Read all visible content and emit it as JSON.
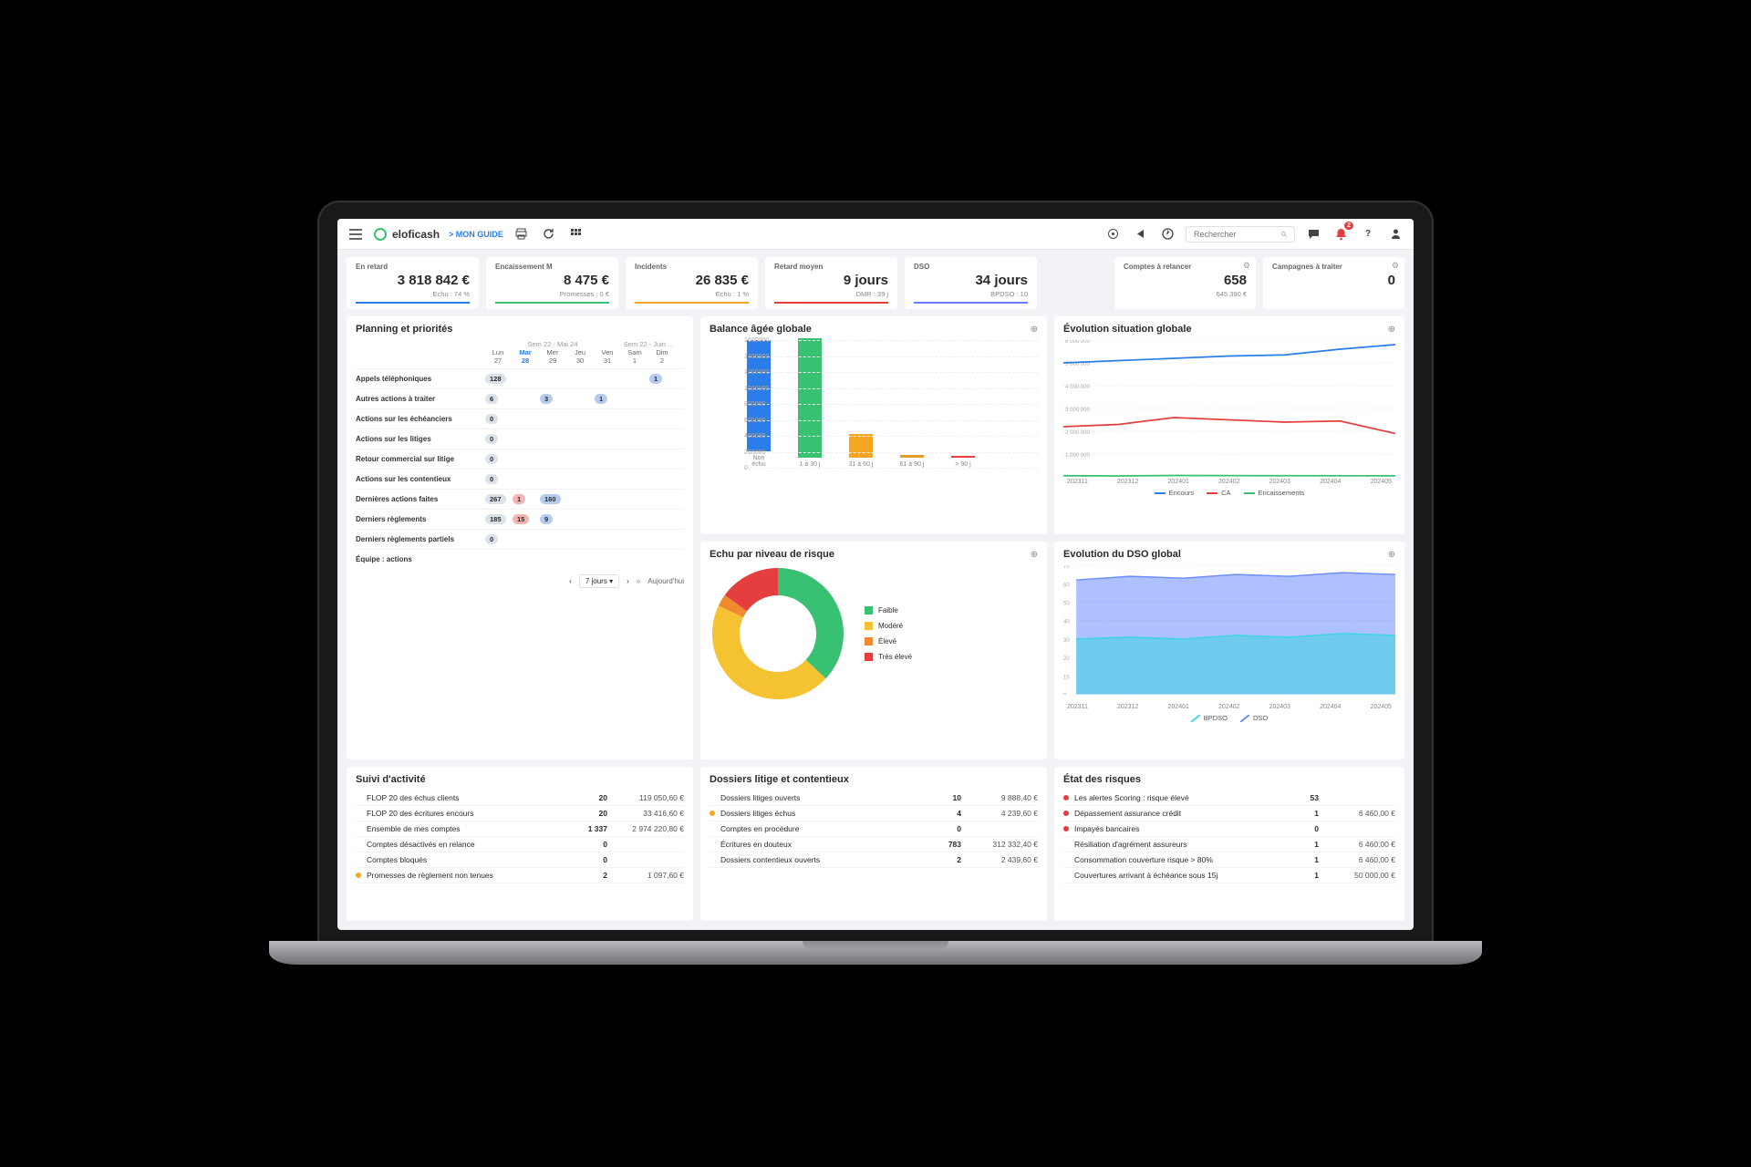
{
  "header": {
    "brand": "eloficash",
    "guide_label": "> MON GUIDE",
    "search_placeholder": "Rechercher",
    "notif_count": "2"
  },
  "kpis": [
    {
      "label": "En retard",
      "value": "3 818 842 €",
      "sub": "Echu : 74 %",
      "color": "#2b7de9"
    },
    {
      "label": "Encaissement M",
      "value": "8 475 €",
      "sub": "Promesses : 0 €",
      "color": "#38c172"
    },
    {
      "label": "Incidents",
      "value": "26 835 €",
      "sub": "Echu : 1 %",
      "color": "#f5a623"
    },
    {
      "label": "Retard moyen",
      "value": "9 jours",
      "sub": "DMR : 39 j",
      "color": "#e53e3e"
    },
    {
      "label": "DSO",
      "value": "34 jours",
      "sub": "BPDSO : 10",
      "color": "#6b7cff"
    }
  ],
  "kpis_right": [
    {
      "label": "Comptes à relancer",
      "value": "658",
      "sub": "645 390 €"
    },
    {
      "label": "Campagnes à traiter",
      "value": "0",
      "sub": ""
    }
  ],
  "balance": {
    "title": "Balance âgée globale",
    "ymax_label": "1 600 000"
  },
  "evolution": {
    "title": "Évolution situation globale",
    "legend": [
      "Encours",
      "CA",
      "Encaissements"
    ]
  },
  "risk": {
    "title": "Echu par niveau de risque",
    "legend": [
      "Faible",
      "Modéré",
      "Élevé",
      "Très élevé"
    ]
  },
  "dso": {
    "title": "Evolution du DSO global",
    "legend": [
      "BPDSO",
      "DSO"
    ]
  },
  "planning": {
    "title": "Planning et priorités",
    "week1": "Sem 22 - Mai 24",
    "week2": "Sem 22 - Juin ...",
    "days_short": [
      "Lun",
      "Mar",
      "Mer",
      "Jeu",
      "Ven",
      "Sam",
      "Dim"
    ],
    "days_num": [
      "27",
      "28",
      "29",
      "30",
      "31",
      "1",
      "2"
    ],
    "rows": [
      {
        "label": "Appels téléphoniques",
        "cells": [
          "128",
          "",
          "",
          "",
          "",
          "",
          "1"
        ]
      },
      {
        "label": "Autres actions à traiter",
        "cells": [
          "6",
          "",
          "3",
          "",
          "1",
          "",
          ""
        ]
      },
      {
        "label": "Actions sur les échéanciers",
        "cells": [
          "0",
          "",
          "",
          "",
          "",
          "",
          ""
        ]
      },
      {
        "label": "Actions sur les litiges",
        "cells": [
          "0",
          "",
          "",
          "",
          "",
          "",
          ""
        ]
      },
      {
        "label": "Retour commercial sur litige",
        "cells": [
          "0",
          "",
          "",
          "",
          "",
          "",
          ""
        ]
      },
      {
        "label": "Actions sur les contentieux",
        "cells": [
          "0",
          "",
          "",
          "",
          "",
          "",
          ""
        ]
      },
      {
        "label": "Dernières actions faites",
        "cells": [
          "267",
          "1",
          "160",
          "",
          "",
          "",
          ""
        ]
      },
      {
        "label": "Derniers règlements",
        "cells": [
          "185",
          "15",
          "9",
          "",
          "",
          "",
          ""
        ]
      },
      {
        "label": "Derniers règlements partiels",
        "cells": [
          "0",
          "",
          "",
          "",
          "",
          "",
          ""
        ]
      },
      {
        "label": "Équipe : actions",
        "cells": [
          "",
          "",
          "",
          "",
          "",
          "",
          ""
        ]
      }
    ],
    "range": "7 jours",
    "today": "Aujourd'hui"
  },
  "suivi": {
    "title": "Suivi d'activité",
    "rows": [
      {
        "label": "FLOP 20 des échus clients",
        "count": "20",
        "value": "119 050,60 €"
      },
      {
        "label": "FLOP 20 des écritures encours",
        "count": "20",
        "value": "33 416,60 €"
      },
      {
        "label": "Ensemble de mes comptes",
        "count": "1 337",
        "value": "2 974 220,80 €"
      },
      {
        "label": "Comptes désactivés en relance",
        "count": "0",
        "value": ""
      },
      {
        "label": "Comptes bloqués",
        "count": "0",
        "value": ""
      },
      {
        "label": "Promesses de règlement non tenues",
        "count": "2",
        "value": "1 097,60 €",
        "dot": "#f5a623"
      }
    ]
  },
  "litige": {
    "title": "Dossiers litige et contentieux",
    "rows": [
      {
        "label": "Dossiers litiges ouverts",
        "count": "10",
        "value": "9 888,40 €"
      },
      {
        "label": "Dossiers litiges échus",
        "count": "4",
        "value": "4 239,60 €",
        "dot": "#f5a623"
      },
      {
        "label": "Comptes en procédure",
        "count": "0",
        "value": ""
      },
      {
        "label": "Écritures en douteux",
        "count": "783",
        "value": "312 332,40 €"
      },
      {
        "label": "Dossiers contentieux ouverts",
        "count": "2",
        "value": "2 439,60 €"
      }
    ]
  },
  "risques": {
    "title": "État des risques",
    "rows": [
      {
        "label": "Les alertes Scoring : risque élevé",
        "count": "53",
        "value": "",
        "dot": "#e53e3e"
      },
      {
        "label": "Dépassement assurance crédit",
        "count": "1",
        "value": "6 460,00 €",
        "dot": "#e53e3e"
      },
      {
        "label": "Impayés bancaires",
        "count": "0",
        "value": "",
        "dot": "#e53e3e"
      },
      {
        "label": "Résiliation d'agrément assureurs",
        "count": "1",
        "value": "6 460,00 €"
      },
      {
        "label": "Consommation couverture risque > 80%",
        "count": "1",
        "value": "6 460,00 €"
      },
      {
        "label": "Couvertures arrivant à échéance sous 15j",
        "count": "1",
        "value": "50 000,00 €"
      }
    ]
  },
  "chart_data": {
    "balance_bar": {
      "type": "bar",
      "categories": [
        "Non échu",
        "1 à 30 j",
        "31 à 60 j",
        "61 à 90 j",
        "> 90 j"
      ],
      "values": [
        1400000,
        1500000,
        300000,
        30000,
        20000
      ],
      "colors": [
        "#2b7de9",
        "#38c172",
        "#f5a623",
        "#e89b2d",
        "#e53e3e"
      ],
      "ylim": [
        0,
        1600000
      ]
    },
    "evolution_line": {
      "type": "line",
      "x": [
        "202311",
        "202312",
        "202401",
        "202402",
        "202403",
        "202404",
        "202405"
      ],
      "series": [
        {
          "name": "Encours",
          "values": [
            5000000,
            5100000,
            5200000,
            5300000,
            5350000,
            5600000,
            5800000
          ],
          "color": "#2b7de9"
        },
        {
          "name": "CA",
          "values": [
            2200000,
            2300000,
            2600000,
            2500000,
            2400000,
            2450000,
            1900000
          ],
          "color": "#e53e3e"
        },
        {
          "name": "Encaissements",
          "values": [
            50000,
            40000,
            60000,
            55000,
            50000,
            48000,
            45000
          ],
          "color": "#38c172"
        }
      ],
      "ylim": [
        0,
        6000000
      ]
    },
    "risk_donut": {
      "type": "pie",
      "labels": [
        "Faible",
        "Modéré",
        "Élevé",
        "Très élevé"
      ],
      "values": [
        37,
        45,
        3,
        15
      ],
      "colors": [
        "#38c172",
        "#f5c331",
        "#f08a2d",
        "#e53e3e"
      ]
    },
    "dso_area": {
      "type": "area",
      "x": [
        "202311",
        "202312",
        "202401",
        "202402",
        "202403",
        "202404",
        "202405"
      ],
      "series": [
        {
          "name": "DSO",
          "values": [
            62,
            64,
            63,
            65,
            64,
            66,
            65
          ],
          "color": "#6b8cff"
        },
        {
          "name": "BPDSO",
          "values": [
            30,
            31,
            30,
            32,
            31,
            33,
            32
          ],
          "color": "#3dd6e0"
        }
      ],
      "ylim": [
        0,
        70
      ]
    }
  }
}
